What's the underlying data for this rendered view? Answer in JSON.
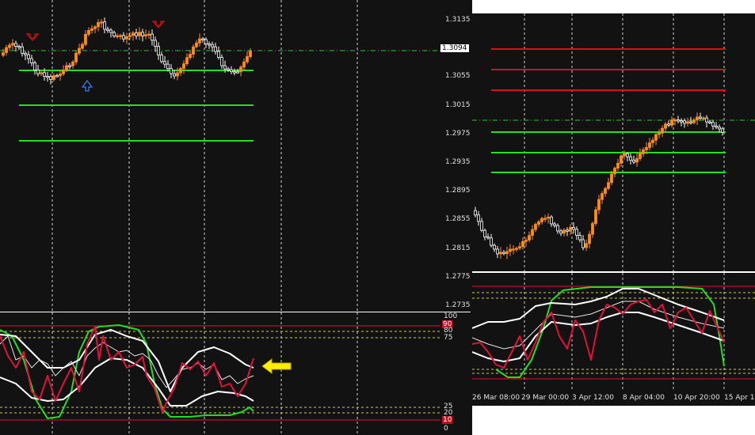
{
  "left_price_axis": {
    "labels": [
      "1.3135",
      "1.3094",
      "1.3055",
      "1.3015",
      "1.2975",
      "1.2935",
      "1.2895",
      "1.2855",
      "1.2815",
      "1.2775",
      "1.2735"
    ],
    "current_price": "1.3094"
  },
  "left_indicator_axis": {
    "labels": [
      "100",
      "90",
      "80",
      "75",
      "25",
      "20",
      "10",
      "0"
    ]
  },
  "right_time_axis": {
    "labels": [
      "26 Mar 08:00",
      "29 Mar 00:00",
      "3 Apr 12:00",
      "8 Apr 04:00",
      "10 Apr 20:00",
      "15 Apr 1"
    ]
  },
  "colors": {
    "background": "#121212",
    "bull_candle": "#ff8c1a",
    "bear_candle": "#ffffff",
    "green_level": "#22e022",
    "red_level": "#e01010",
    "oscillator_red": "#e0103a",
    "oscillator_green": "#22dd22",
    "band_white": "#ffffff",
    "annotation_arrow": "#ffee00"
  },
  "annotations": {
    "sell_arrow_icon": "down-arrow-icon",
    "buy_arrow_icon": "up-arrow-icon",
    "pointer_icon": "left-arrow-icon"
  }
}
